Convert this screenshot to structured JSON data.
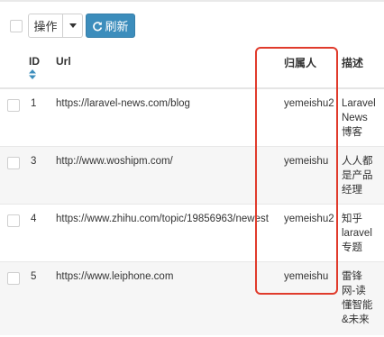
{
  "toolbar": {
    "operation_label": "操作",
    "refresh_label": "刷新"
  },
  "columns": {
    "id": "ID",
    "url": "Url",
    "owner": "归属人",
    "description": "描述"
  },
  "rows": [
    {
      "id": "1",
      "url": "https://laravel-news.com/blog",
      "owner": "yemeishu2",
      "description": [
        "Laravel",
        "News",
        "博客"
      ]
    },
    {
      "id": "3",
      "url": "http://www.woshipm.com/",
      "owner": "yemeishu",
      "description": [
        "人人都",
        "是产品",
        "经理"
      ]
    },
    {
      "id": "4",
      "url": "https://www.zhihu.com/topic/19856963/newest",
      "owner": "yemeishu2",
      "description": [
        "知乎",
        "laravel",
        "专题"
      ]
    },
    {
      "id": "5",
      "url": "https://www.leiphone.com",
      "owner": "yemeishu",
      "description": [
        "雷锋",
        "网-读",
        "懂智能",
        "&未来"
      ]
    }
  ],
  "colors": {
    "primary": "#3c8dbc",
    "highlight": "#e03b2c",
    "row_alt": "#f6f6f6"
  }
}
